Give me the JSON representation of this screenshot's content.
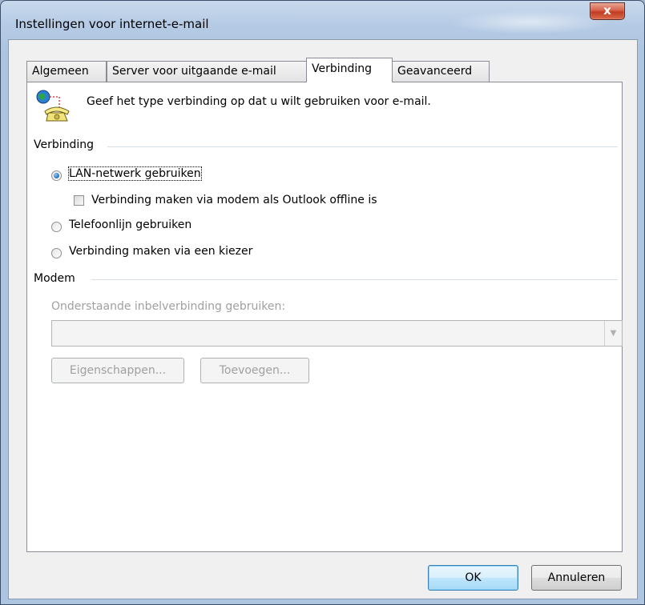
{
  "window": {
    "title": "Instellingen voor internet-e-mail",
    "close_label": "x"
  },
  "tabs": [
    {
      "label": "Algemeen",
      "active": false
    },
    {
      "label": "Server voor uitgaande e-mail",
      "active": false
    },
    {
      "label": "Verbinding",
      "active": true
    },
    {
      "label": "Geavanceerd",
      "active": false
    }
  ],
  "intro": {
    "text": "Geef het type verbinding op dat u wilt gebruiken voor e-mail.",
    "icon": "network-phone-icon"
  },
  "connection_group": {
    "label": "Verbinding",
    "options": {
      "lan": {
        "label": "LAN-netwerk gebruiken",
        "checked": true
      },
      "modem_offline": {
        "label": "Verbinding maken via modem als Outlook offline is",
        "checked": false
      },
      "phone": {
        "label": "Telefoonlijn gebruiken",
        "checked": false
      },
      "dialer": {
        "label": "Verbinding maken via een kiezer",
        "checked": false
      }
    }
  },
  "modem_group": {
    "label": "Modem",
    "dialup_label": "Onderstaande inbelverbinding gebruiken:",
    "dialup_value": "",
    "properties_button": "Eigenschappen...",
    "add_button": "Toevoegen..."
  },
  "footer": {
    "ok": "OK",
    "cancel": "Annuleren"
  },
  "colors": {
    "accent": "#1b6fc2",
    "close": "#c23b22"
  }
}
